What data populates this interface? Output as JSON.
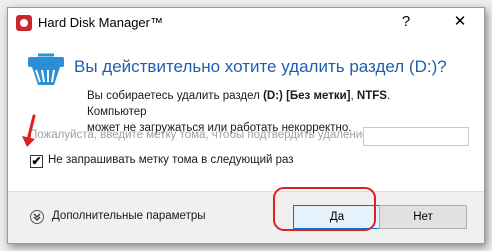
{
  "window": {
    "title": "Hard Disk Manager™",
    "help_glyph": "?",
    "close_glyph": "✕"
  },
  "dialog": {
    "heading": "Вы действительно хотите удалить раздел (D:)?",
    "desc_line1_pre": "Вы собираетесь удалить раздел ",
    "desc_line1_bold": "(D:) [Без метки]",
    "desc_line1_mid": ", ",
    "desc_line1_bold2": "NTFS",
    "desc_line1_post": ". Компьютер",
    "desc_line2": "может не загружаться или работать некорректно.",
    "prompt_label": "Пожалуйста, введите метку тома, чтобы подтвердить удаление:",
    "prompt_value": "",
    "checkbox_label": "Не запрашивать метку тома в следующий раз",
    "checkbox_checked": true,
    "checkbox_mark": "✔"
  },
  "footer": {
    "advanced_label": "Дополнительные параметры",
    "yes_label": "Да",
    "no_label": "Нет"
  },
  "colors": {
    "heading": "#1f5fb0",
    "annotation": "#e02020",
    "icon_accent": "#c8272d"
  },
  "icons": {
    "app": "app-logo-icon",
    "header": "delete-partition-icon",
    "advanced": "expand-chevron-icon"
  }
}
